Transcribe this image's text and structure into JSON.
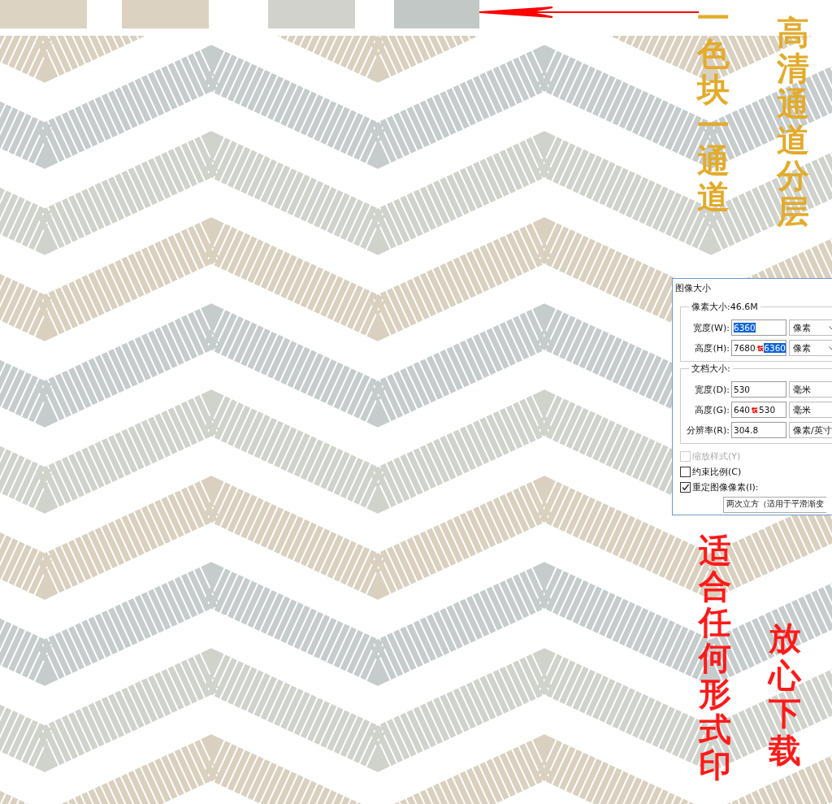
{
  "color_swatches": [
    {
      "color": "#dcd3c3"
    },
    {
      "color": "#dcd2c2"
    },
    {
      "color": "#d1d2cb"
    },
    {
      "color": "#c2c8c6"
    }
  ],
  "captions": [
    {
      "text": "一色块一通道",
      "color": "#e2ab2c"
    },
    {
      "text": "高清通道分层",
      "color": "#e2ab2c"
    },
    {
      "text": "适合任何形式印",
      "color": "#ff1a1a"
    },
    {
      "text": "放心下载",
      "color": "#ff1a1a"
    }
  ],
  "dialog": {
    "title": "图像大小",
    "groups": [
      {
        "legend": "像素大小:46.6M",
        "rows": [
          {
            "label": "宽度(W):",
            "value": "6360",
            "highlighted": true,
            "unit": "像素"
          },
          {
            "label": "高度(H):",
            "value": "7680",
            "replacement": "6360",
            "highlighted": true,
            "unit": "像素"
          }
        ]
      },
      {
        "legend": "文档大小:",
        "rows": [
          {
            "label": "宽度(D):",
            "value": "530",
            "highlighted": false,
            "unit": "毫米"
          },
          {
            "label": "高度(G):",
            "value": "640",
            "replacement": "530",
            "highlighted": false,
            "unit": "毫米"
          },
          {
            "label": "分辨率(R):",
            "value": "304.8",
            "highlighted": false,
            "unit": "像素/英寸"
          }
        ]
      }
    ],
    "checkboxes": [
      {
        "label": "缩放样式(Y)",
        "checked": false,
        "disabled": true
      },
      {
        "label": "约束比例(C)",
        "checked": false,
        "disabled": false
      },
      {
        "label": "重定图像像素(I):",
        "checked": true,
        "disabled": false
      }
    ],
    "method": "两次立方（适用于平滑渐变"
  }
}
